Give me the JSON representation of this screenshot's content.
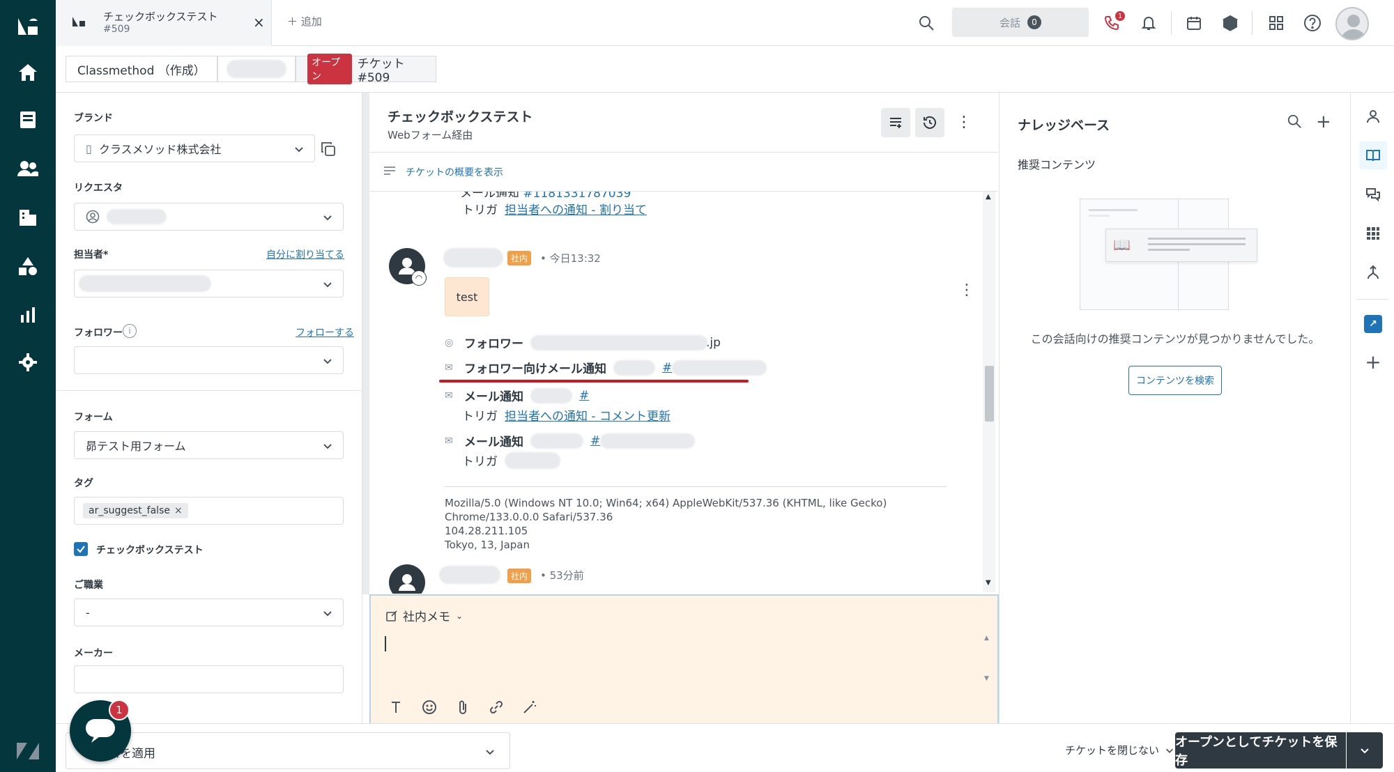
{
  "tab": {
    "title": "チェックボックステスト",
    "subtitle": "#509",
    "add_label": "追加"
  },
  "topbar": {
    "conversation_label": "会話",
    "conversation_count": "0",
    "phone_badge": "1"
  },
  "crumbs": {
    "org": "Classmethod （作成）",
    "status": "オープン",
    "ticket": "チケット #509"
  },
  "props": {
    "brand_label": "ブランド",
    "brand_value": "クラスメソッド株式会社",
    "requester_label": "リクエスタ",
    "assignee_label": "担当者*",
    "assign_self": "自分に割り当てる",
    "followers_label": "フォロワー",
    "follow_link": "フォローする",
    "form_label": "フォーム",
    "form_value": "昴テスト用フォーム",
    "tags_label": "タグ",
    "tag_value": "ar_suggest_false",
    "checkbox_label": "チェックボックステスト",
    "occupation_label": "ご職業",
    "occupation_value": "-",
    "maker_label": "メーカー"
  },
  "conversation": {
    "title": "チェックボックステスト",
    "subtitle": "Webフォーム経由",
    "summary_link": "チケットの概要を表示",
    "top_trigger_label": "トリガ",
    "top_trigger_link": "担当者への通知 - 割り当て",
    "message": {
      "badge": "社内",
      "time": "今日13:32",
      "body": "test",
      "follower_label": "フォロワー",
      "follower_suffix": ".jp",
      "follower_mail_label": "フォロワー向けメール通知",
      "follower_mail_link": "#",
      "mail1_label": "メール通知",
      "mail1_link": "#",
      "trigger1_label": "トリガ",
      "trigger1_link": "担当者への通知 - コメント更新",
      "mail2_label": "メール通知",
      "mail2_link": "#",
      "trigger2_label": "トリガ",
      "ua_line1": "Mozilla/5.0 (Windows NT 10.0; Win64; x64) AppleWebKit/537.36 (KHTML, like Gecko)",
      "ua_line2": "Chrome/133.0.0.0 Safari/537.36",
      "ip": "104.28.211.105",
      "location": "Tokyo, 13, Japan"
    },
    "next_message": {
      "badge": "社内",
      "time": "53分前"
    }
  },
  "composer": {
    "mode": "社内メモ"
  },
  "kb": {
    "title": "ナレッジベース",
    "recommended": "推奨コンテンツ",
    "empty_text": "この会話向けの推奨コンテンツが見つかりませんでした。",
    "search_button": "コンテンツを検索"
  },
  "bottom": {
    "macro_label": "マクロを適用",
    "close_toggle": "チケットを閉じない",
    "save_label": "オープンとしてチケットを保存",
    "chat_badge": "1"
  },
  "colors": {
    "nav": "#03363d",
    "accent_red": "#cc3340",
    "link": "#1f73b7",
    "composer_bg": "#fff3e5",
    "internal_badge": "#f0a04a"
  }
}
